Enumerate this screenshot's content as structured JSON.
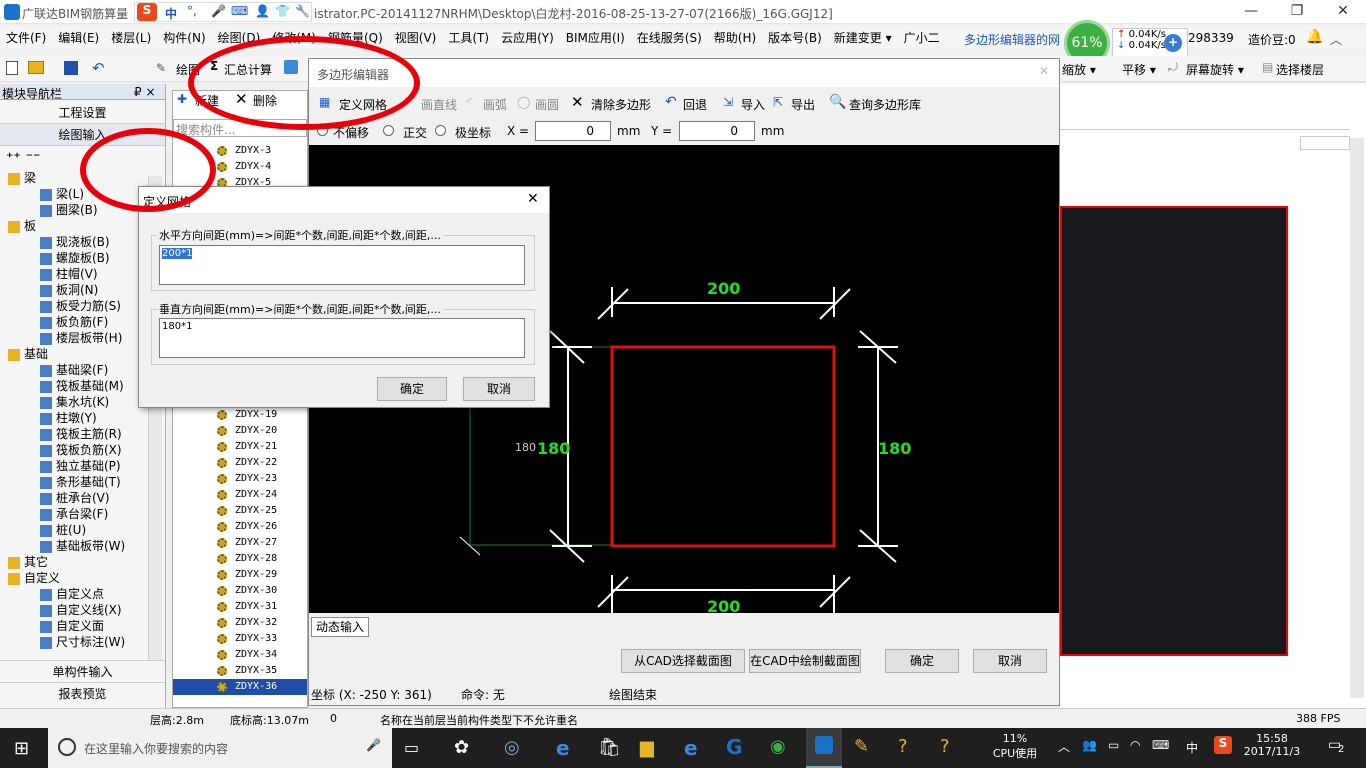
{
  "app": {
    "title_prefix": "广联达BIM钢筋算量",
    "title_path": "istrator.PC-20141127NRHM\\Desktop\\白龙村-2016-08-25-13-27-07(2166版)_16G.GGJ12]",
    "ime": "中"
  },
  "menu": [
    "文件(F)",
    "编辑(E)",
    "楼层(L)",
    "构件(N)",
    "绘图(D)",
    "修改(M)",
    "钢筋量(Q)",
    "视图(V)",
    "工具(T)",
    "云应用(Y)",
    "BIM应用(I)",
    "在线服务(S)",
    "帮助(H)",
    "版本号(B)",
    "新建变更 ▾",
    "广小二"
  ],
  "header_right": {
    "banner": "多边形编辑器的网",
    "percent": "61%",
    "up": "0.04K/s",
    "down": "0.04K/s",
    "id_text": "298339",
    "price_label": "造价豆:0"
  },
  "toolbar": {
    "draw": "绘图",
    "sum": "汇总计算",
    "zoom": "缩放 ▾",
    "pan": "平移 ▾",
    "rotate": "屏幕旋转 ▾",
    "floor": "选择楼层"
  },
  "left_panel": {
    "title": "模块导航栏",
    "pin": "₽ ×",
    "project_settings": "工程设置",
    "draw_input": "绘图输入",
    "single_input": "单构件输入",
    "report": "报表预览"
  },
  "tree": [
    {
      "t": "梁",
      "lvl": 0
    },
    {
      "t": "梁(L)",
      "lvl": 1
    },
    {
      "t": "圈梁(B)",
      "lvl": 1
    },
    {
      "t": "板",
      "lvl": 0
    },
    {
      "t": "现浇板(B)",
      "lvl": 1
    },
    {
      "t": "螺旋板(B)",
      "lvl": 1
    },
    {
      "t": "柱帽(V)",
      "lvl": 1
    },
    {
      "t": "板洞(N)",
      "lvl": 1
    },
    {
      "t": "板受力筋(S)",
      "lvl": 1
    },
    {
      "t": "板负筋(F)",
      "lvl": 1
    },
    {
      "t": "楼层板带(H)",
      "lvl": 1
    },
    {
      "t": "基础",
      "lvl": 0
    },
    {
      "t": "基础梁(F)",
      "lvl": 1
    },
    {
      "t": "筏板基础(M)",
      "lvl": 1
    },
    {
      "t": "集水坑(K)",
      "lvl": 1
    },
    {
      "t": "柱墩(Y)",
      "lvl": 1
    },
    {
      "t": "筏板主筋(R)",
      "lvl": 1
    },
    {
      "t": "筏板负筋(X)",
      "lvl": 1
    },
    {
      "t": "独立基础(P)",
      "lvl": 1
    },
    {
      "t": "条形基础(T)",
      "lvl": 1
    },
    {
      "t": "桩承台(V)",
      "lvl": 1
    },
    {
      "t": "承台梁(F)",
      "lvl": 1
    },
    {
      "t": "桩(U)",
      "lvl": 1
    },
    {
      "t": "基础板带(W)",
      "lvl": 1
    },
    {
      "t": "其它",
      "lvl": 0
    },
    {
      "t": "自定义",
      "lvl": 0
    },
    {
      "t": "自定义点",
      "lvl": 1
    },
    {
      "t": "自定义线(X)",
      "lvl": 1
    },
    {
      "t": "自定义面",
      "lvl": 1
    },
    {
      "t": "尺寸标注(W)",
      "lvl": 1
    }
  ],
  "list": {
    "new": "新建",
    "delete": "删除",
    "search_placeholder": "搜索构件...",
    "items": [
      "ZDYX-3",
      "ZDYX-4",
      "ZDYX-5",
      "ZDYX-19",
      "ZDYX-20",
      "ZDYX-21",
      "ZDYX-22",
      "ZDYX-23",
      "ZDYX-24",
      "ZDYX-25",
      "ZDYX-26",
      "ZDYX-27",
      "ZDYX-28",
      "ZDYX-29",
      "ZDYX-30",
      "ZDYX-31",
      "ZDYX-32",
      "ZDYX-33",
      "ZDYX-34",
      "ZDYX-35",
      "ZDYX-36"
    ]
  },
  "poly": {
    "title": "多边形编辑器",
    "define_grid": "定义网格",
    "draw_line": "画直线",
    "draw_arc": "画弧",
    "draw_circle": "画圆",
    "clear": "清除多边形",
    "undo": "回退",
    "import": "导入",
    "export": "导出",
    "query": "查询多边形库",
    "no_offset": "不偏移",
    "ortho": "正交",
    "polar": "极坐标",
    "x_label": "X =",
    "y_label": "Y =",
    "x_val": "0",
    "y_val": "0",
    "unit": "mm",
    "dim_top": "200",
    "dim_bottom": "200",
    "dim_left": "180",
    "dim_right": "180",
    "dim_left_small": "180",
    "dynamic_input": "动态输入",
    "from_cad": "从CAD选择截面图",
    "draw_cad": "在CAD中绘制截面图",
    "ok": "确定",
    "cancel": "取消",
    "coord": "坐标 (X: -250 Y: 361)",
    "command": "命令: 无",
    "status": "绘图结束"
  },
  "dlg": {
    "title": "定义网格",
    "h_label": "水平方向间距(mm)=>间距*个数,间距,间距*个数,间距,...",
    "h_val": "200*1",
    "v_label": "垂直方向间距(mm)=>间距*个数,间距,间距*个数,间距,...",
    "v_val": "180*1",
    "ok": "确定",
    "cancel": "取消"
  },
  "status": {
    "floor_h": "层高:2.8m",
    "base_h": "底标高:13.07m",
    "num": "0",
    "msg": "名称在当前层当前构件类型下不允许重名",
    "fps": "388 FPS"
  },
  "taskbar": {
    "search": "在这里输入你要搜索的内容",
    "cpu_pct": "11%",
    "cpu_label": "CPU使用",
    "ime": "中",
    "time": "15:58",
    "date": "2017/11/3",
    "notif": "2"
  }
}
